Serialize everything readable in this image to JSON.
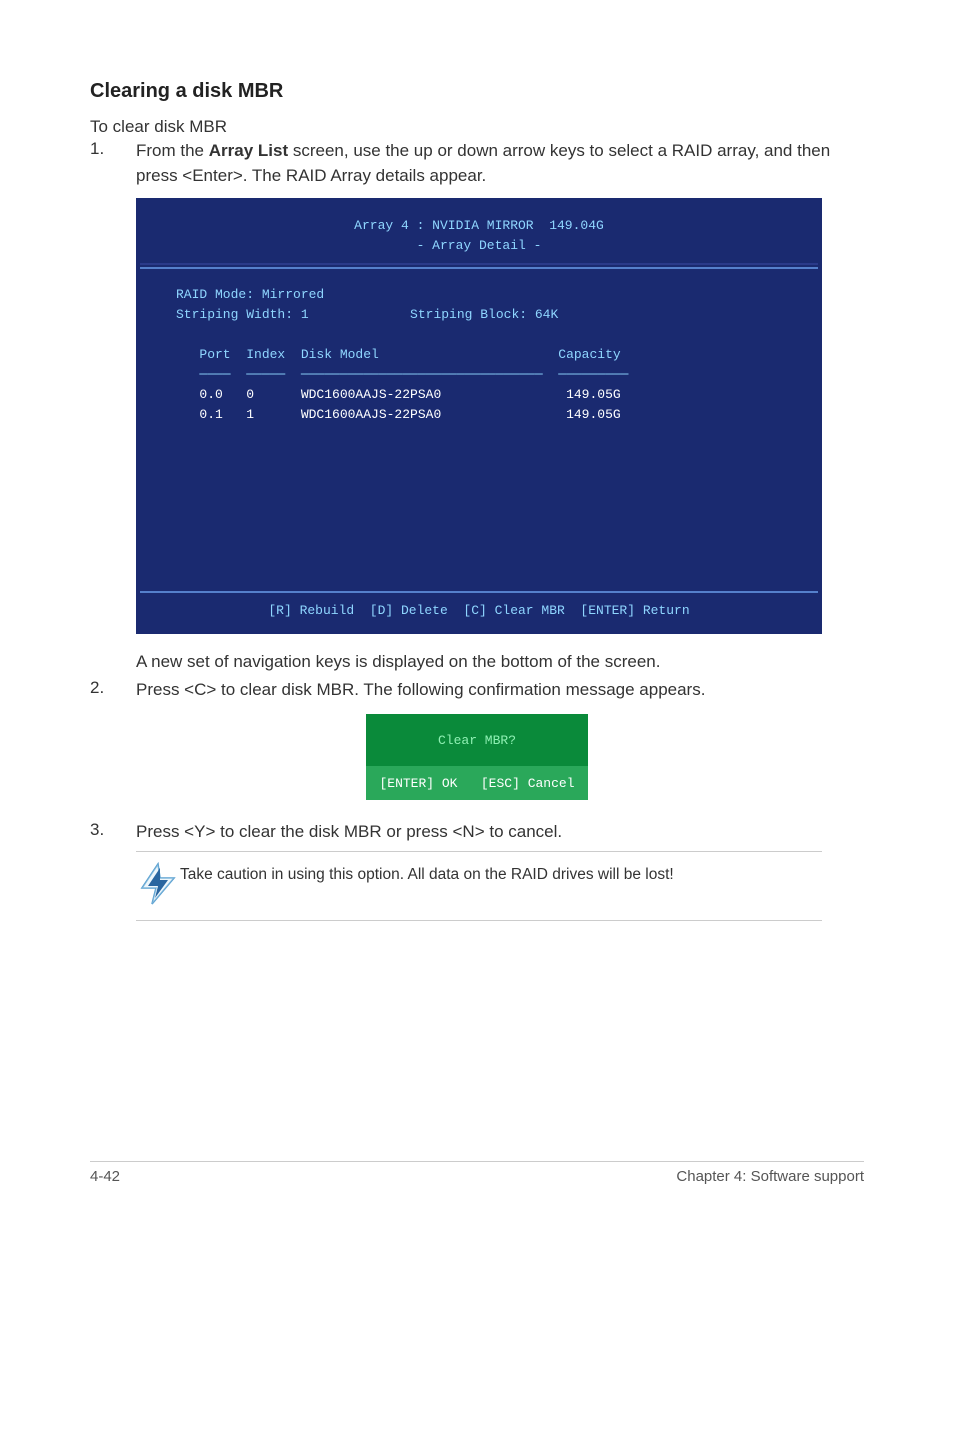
{
  "section_heading": "Clearing a disk MBR",
  "intro_text": "To clear disk MBR",
  "step1": {
    "num": "1.",
    "text_a": "From the ",
    "bold": "Array List",
    "text_b": " screen, use the up or down arrow keys to select a RAID array, and then press <Enter>. The RAID Array details appear."
  },
  "bios": {
    "title_line1": "Array 4 : NVIDIA MIRROR  149.04G",
    "title_line2": "- Array Detail -",
    "raid_mode": "RAID Mode: Mirrored",
    "striping": "Striping Width: 1             Striping Block: 64K",
    "header": "   Port  Index  Disk Model                       Capacity",
    "underline": "   ────  ─────  ───────────────────────────────  ─────────",
    "row1": "   0.0   0      WDC1600AAJS-22PSA0                149.05G",
    "row2": "   0.1   1      WDC1600AAJS-22PSA0                149.05G",
    "footer": "[R] Rebuild  [D] Delete  [C] Clear MBR  [ENTER] Return"
  },
  "after_bios": "A new set of navigation keys is displayed on the bottom of the screen.",
  "step2": {
    "num": "2.",
    "text": "Press <C> to clear disk MBR. The following confirmation message appears."
  },
  "confirm": {
    "question": "Clear MBR?",
    "buttons": "[ENTER] OK   [ESC] Cancel"
  },
  "step3": {
    "num": "3.",
    "text": "Press <Y> to clear the disk MBR or press <N> to cancel."
  },
  "caution_text": "Take caution in using this option. All data on the RAID drives will be lost!",
  "footer": {
    "left": "4-42",
    "right": "Chapter 4: Software support"
  }
}
